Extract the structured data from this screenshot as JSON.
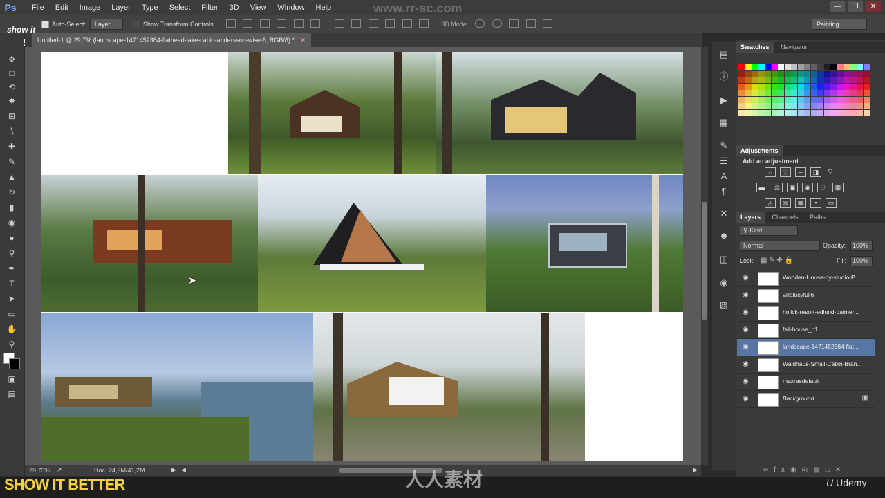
{
  "menu": {
    "logo": "Ps",
    "items": [
      "File",
      "Edit",
      "Image",
      "Layer",
      "Type",
      "Select",
      "Filter",
      "3D",
      "View",
      "Window",
      "Help"
    ]
  },
  "options": {
    "auto_select_label": "Auto-Select:",
    "auto_select_value": "Layer",
    "show_transform_label": "Show Transform Controls",
    "mode_3d_label": "3D Mode:",
    "workspace": "Painting"
  },
  "document": {
    "tab_title": "Untitled-1 @ 29,7% (landscape-1471452384-flathead-lake-cabin-andersson-wise-6, RGB/8) *",
    "zoom": "29,73%",
    "doc_size": "Doc: 24,9M/41,2M"
  },
  "panels": {
    "swatches_tab": "Swatches",
    "navigator_tab": "Navigator",
    "adjustments_tab": "Adjustments",
    "add_adjustment": "Add an adjustment",
    "layers_tab": "Layers",
    "channels_tab": "Channels",
    "paths_tab": "Paths",
    "kind_filter": "Kind",
    "blend_mode": "Normal",
    "opacity_label": "Opacity:",
    "opacity_value": "100%",
    "lock_label": "Lock:",
    "fill_label": "Fill:",
    "fill_value": "100%"
  },
  "layers": [
    {
      "name": "Wooden-House-by-studio-P...",
      "selected": false
    },
    {
      "name": "villalucyfull6",
      "selected": false
    },
    {
      "name": "holick-resort-edlund-palmer...",
      "selected": false
    },
    {
      "name": "fall-house_p1",
      "selected": false
    },
    {
      "name": "landscape-1471452384-flat...",
      "selected": true
    },
    {
      "name": "Waldhaus-Small-Cabin-Bran...",
      "selected": false
    },
    {
      "name": "maxresdefault",
      "selected": false
    },
    {
      "name": "Background",
      "selected": false
    }
  ],
  "branding": {
    "corner_logo_top": "show it",
    "corner_logo_bottom": "better",
    "bottom_banner": "SHOW IT BETTER",
    "udemy": "Udemy",
    "site_watermark": "www.rr-sc.com",
    "cn_watermark": "人人素材"
  },
  "colors": {
    "menubar": "#3c3c3c",
    "panel": "#3a3a3a",
    "selected_layer": "#5876a3",
    "banner_yellow": "#f2d13a"
  }
}
